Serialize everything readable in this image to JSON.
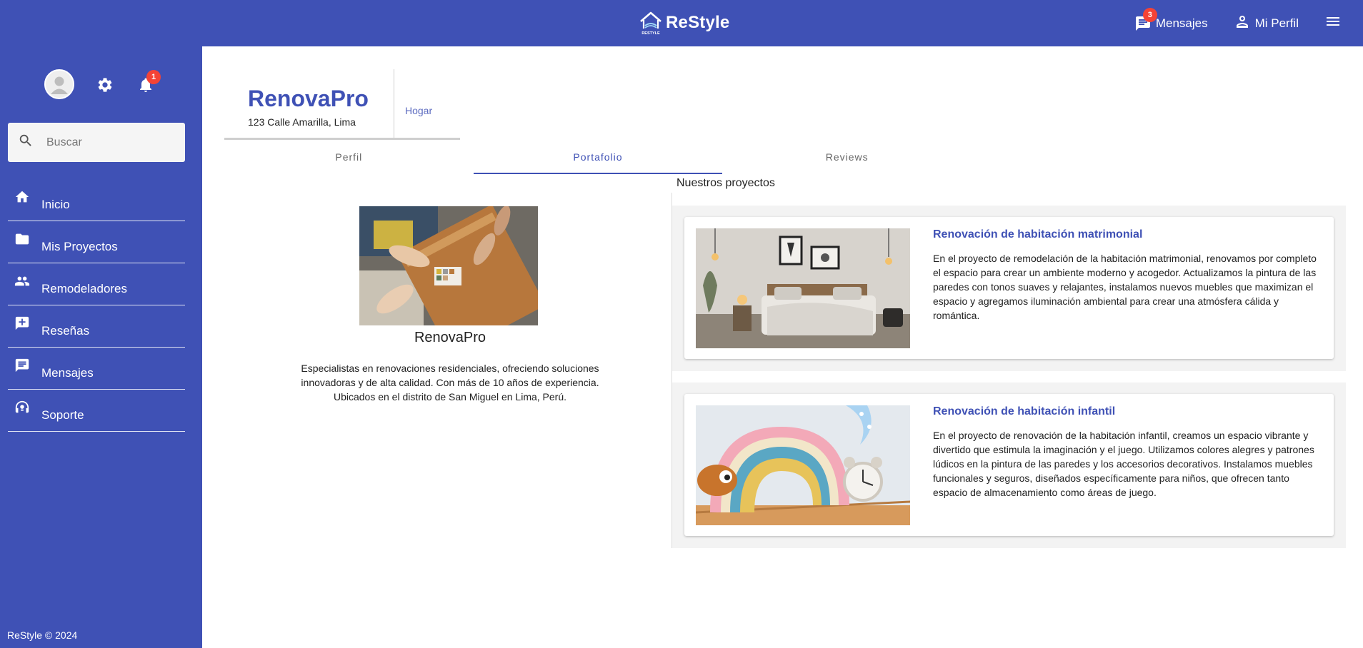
{
  "header": {
    "brand_name": "ReStyle",
    "brand_logo_text": "RESTYLE",
    "messages_label": "Mensajes",
    "messages_badge": "3",
    "profile_label": "Mi Perfil",
    "colors": {
      "primary": "#3f51b5",
      "badge": "#f44336"
    }
  },
  "sidebar": {
    "notifications_badge": "1",
    "search_placeholder": "Buscar",
    "items": [
      {
        "label": "Inicio",
        "icon": "home-icon"
      },
      {
        "label": "Mis Proyectos",
        "icon": "folder-icon"
      },
      {
        "label": "Remodeladores",
        "icon": "people-icon"
      },
      {
        "label": "Reseñas",
        "icon": "review-icon"
      },
      {
        "label": "Mensajes",
        "icon": "chat-icon"
      },
      {
        "label": "Soporte",
        "icon": "support-icon"
      }
    ],
    "footer": "ReStyle © 2024"
  },
  "company": {
    "name": "RenovaPro",
    "address": "123 Calle Amarilla, Lima",
    "category": "Hogar"
  },
  "tabs": [
    {
      "label": "Perfil"
    },
    {
      "label": "Portafolio",
      "active": true
    },
    {
      "label": "Reviews"
    }
  ],
  "profile": {
    "title": "RenovaPro",
    "description": "Especialistas en renovaciones residenciales, ofreciendo soluciones innovadoras y de alta calidad. Con más de 10 años de experiencia. Ubicados en el distrito de San Miguel en Lima, Perú."
  },
  "projects": {
    "heading": "Nuestros proyectos",
    "items": [
      {
        "title": "Renovación de habitación matrimonial",
        "description": "En el proyecto de remodelación de la habitación matrimonial, renovamos por completo el espacio para crear un ambiente moderno y acogedor. Actualizamos la pintura de las paredes con tonos suaves y relajantes, instalamos nuevos muebles que maximizan el espacio y agregamos iluminación ambiental para crear una atmósfera cálida y romántica."
      },
      {
        "title": "Renovación de habitación infantil",
        "description": "En el proyecto de renovación de la habitación infantil, creamos un espacio vibrante y divertido que estimula la imaginación y el juego. Utilizamos colores alegres y patrones lúdicos en la pintura de las paredes y los accesorios decorativos. Instalamos muebles funcionales y seguros, diseñados específicamente para niños, que ofrecen tanto espacio de almacenamiento como áreas de juego."
      }
    ]
  }
}
